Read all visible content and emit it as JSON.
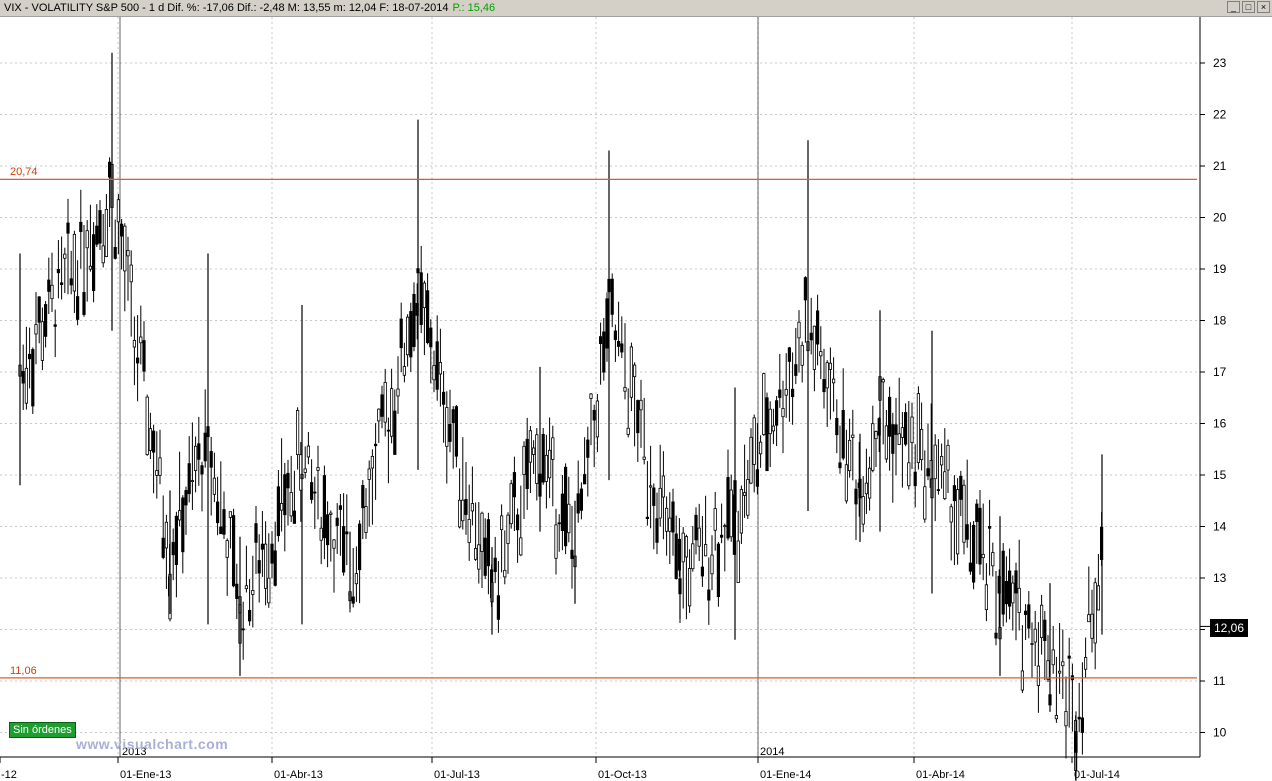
{
  "header": {
    "title": "VIX - VOLATILITY S&P 500 - 1 d  Dif. %: -17,06  Dif.: -2,48  M: 13,55  m: 12,04  F: 18-07-2014",
    "last": "P.: 15,46"
  },
  "levels": [
    {
      "label": "20,74",
      "value": 20.74,
      "color": "#e05a2a"
    },
    {
      "label": "11,06",
      "value": 11.06,
      "color": "#e05a2a"
    }
  ],
  "last_price_label": "12,06",
  "badge": "Sin órdenes",
  "brand": "www.visualchart.com",
  "colors": {
    "candle": "#000000",
    "grid": "#c8c8c8",
    "level": "#e05a2a",
    "badge": "#1e9e2e"
  },
  "chart_data": {
    "type": "candlestick",
    "title": "",
    "yaxis_position": "right",
    "ylim": [
      9.7,
      24.0
    ],
    "yticks": [
      "10",
      "11",
      "12",
      "13",
      "14",
      "15",
      "16",
      "17",
      "18",
      "19",
      "20",
      "21",
      "22",
      "23",
      "24"
    ],
    "xtick_labels": [
      "-12",
      "01-Ene-13",
      "01-Abr-13",
      "01-Jul-13",
      "01-Oct-13",
      "01-Ene-14",
      "01-Abr-14",
      "01-Jul-14"
    ],
    "year_labels": [
      "2013",
      "2014"
    ],
    "grid": true,
    "series": [
      {
        "date": "2012-12",
        "high": 19.3,
        "low": 14.8
      },
      {
        "date": "2012-12-31",
        "high": 23.2,
        "low": 17.8
      },
      {
        "date": "2013-02",
        "high": 14.7,
        "low": 12.3
      },
      {
        "date": "2013-02-25",
        "high": 19.3,
        "low": 12.1
      },
      {
        "date": "2013-03-14",
        "high": 13.8,
        "low": 11.1
      },
      {
        "date": "2013-04-18",
        "high": 18.3,
        "low": 12.1
      },
      {
        "date": "2013-05",
        "high": 13.9,
        "low": 12.4
      },
      {
        "date": "2013-06-20",
        "high": 21.9,
        "low": 15.1
      },
      {
        "date": "2013-07-22",
        "high": 13.6,
        "low": 11.9
      },
      {
        "date": "2013-08-30",
        "high": 17.1,
        "low": 13.9
      },
      {
        "date": "2013-09",
        "high": 14.5,
        "low": 12.5
      },
      {
        "date": "2013-10-08",
        "high": 21.3,
        "low": 14.9
      },
      {
        "date": "2013-11",
        "high": 13.7,
        "low": 12.2
      },
      {
        "date": "2013-12-13",
        "high": 16.7,
        "low": 11.8
      },
      {
        "date": "2014-02-03",
        "high": 21.5,
        "low": 14.3
      },
      {
        "date": "2014-03",
        "high": 15.8,
        "low": 13.7
      },
      {
        "date": "2014-03-14",
        "high": 18.2,
        "low": 13.9
      },
      {
        "date": "2014-04-14",
        "high": 17.8,
        "low": 12.7
      },
      {
        "date": "2014-05",
        "high": 14.2,
        "low": 11.1
      },
      {
        "date": "2014-06",
        "high": 12.9,
        "low": 10.4
      },
      {
        "date": "2014-07-03",
        "high": 10.3,
        "low": 10.3
      },
      {
        "date": "2014-07-17",
        "high": 15.4,
        "low": 11.9
      }
    ]
  }
}
